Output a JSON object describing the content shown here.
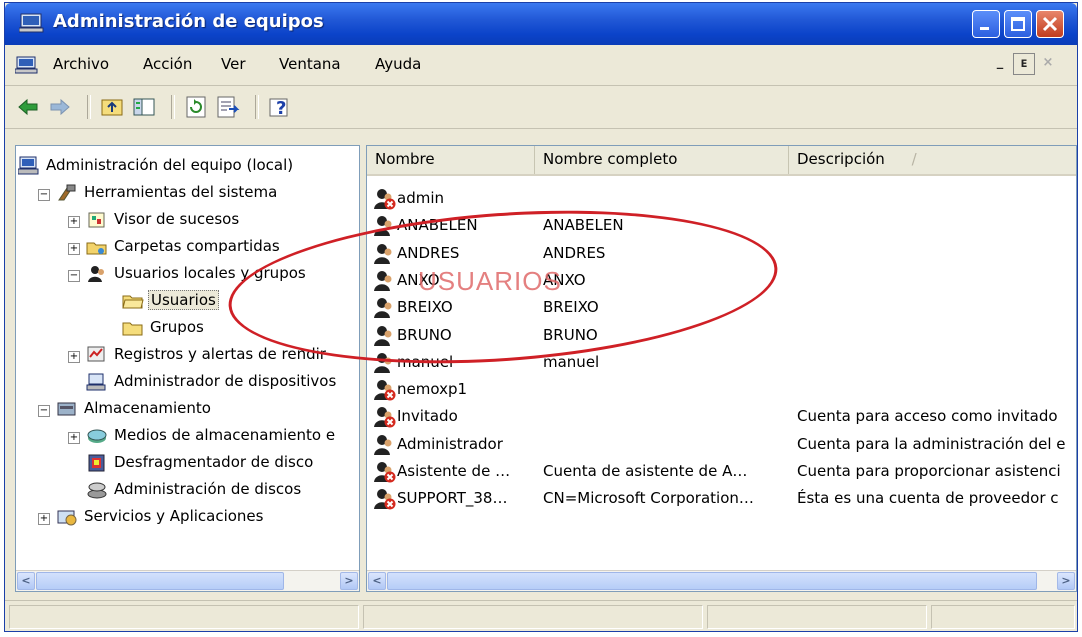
{
  "window": {
    "title": "Administración de equipos"
  },
  "menu": [
    "Archivo",
    "Acción",
    "Ver",
    "Ventana",
    "Ayuda"
  ],
  "toolbar_icons": [
    "back-icon",
    "forward-icon",
    "up-folder-icon",
    "show-hide-tree-icon",
    "refresh-icon",
    "export-list-icon",
    "help-icon"
  ],
  "tree": {
    "root": "Administración del equipo (local)",
    "items": [
      {
        "label": "Herramientas del sistema",
        "level": 1,
        "expander": "minus"
      },
      {
        "label": "Visor de sucesos",
        "level": 2,
        "expander": "plus"
      },
      {
        "label": "Carpetas compartidas",
        "level": 2,
        "expander": "plus"
      },
      {
        "label": "Usuarios locales y grupos",
        "level": 2,
        "expander": "minus"
      },
      {
        "label": "Usuarios",
        "level": 3,
        "expander": "",
        "selected": true
      },
      {
        "label": "Grupos",
        "level": 3,
        "expander": ""
      },
      {
        "label": "Registros y alertas de rendir",
        "level": 2,
        "expander": "plus"
      },
      {
        "label": "Administrador de dispositivos",
        "level": 2,
        "expander": ""
      },
      {
        "label": "Almacenamiento",
        "level": 1,
        "expander": "minus"
      },
      {
        "label": "Medios de almacenamiento e",
        "level": 2,
        "expander": "plus"
      },
      {
        "label": "Desfragmentador de disco",
        "level": 2,
        "expander": ""
      },
      {
        "label": "Administración de discos",
        "level": 2,
        "expander": ""
      },
      {
        "label": "Servicios y Aplicaciones",
        "level": 1,
        "expander": "plus"
      }
    ]
  },
  "list": {
    "columns": [
      "Nombre",
      "Nombre completo",
      "Descripción"
    ],
    "rows": [
      {
        "name": "admin",
        "full": "",
        "desc": "",
        "disabled": true
      },
      {
        "name": "ANABELEN",
        "full": "ANABELEN",
        "desc": "",
        "disabled": false
      },
      {
        "name": "ANDRES",
        "full": "ANDRES",
        "desc": "",
        "disabled": false
      },
      {
        "name": "ANXO",
        "full": "ANXO",
        "desc": "",
        "disabled": false
      },
      {
        "name": "BREIXO",
        "full": "BREIXO",
        "desc": "",
        "disabled": false
      },
      {
        "name": "BRUNO",
        "full": "BRUNO",
        "desc": "",
        "disabled": false
      },
      {
        "name": "manuel",
        "full": "manuel",
        "desc": "",
        "disabled": false
      },
      {
        "name": "nemoxp1",
        "full": "",
        "desc": "",
        "disabled": true
      },
      {
        "name": "Invitado",
        "full": "",
        "desc": "Cuenta para acceso como invitado",
        "disabled": true
      },
      {
        "name": "Administrador",
        "full": "",
        "desc": "Cuenta para la administración del e",
        "disabled": false
      },
      {
        "name": "Asistente de …",
        "full": "Cuenta de asistente de A…",
        "desc": "Cuenta para proporcionar asistenci",
        "disabled": true
      },
      {
        "name": "SUPPORT_38…",
        "full": "CN=Microsoft Corporation…",
        "desc": "Ésta es una cuenta de proveedor c",
        "disabled": true
      }
    ]
  },
  "annotation": {
    "text": "USUARIOS",
    "color": "#cf2026"
  },
  "colors": {
    "titlebar": "#0a3cb8",
    "chrome": "#ece9d8",
    "disabled_x": "#d42a1f"
  }
}
